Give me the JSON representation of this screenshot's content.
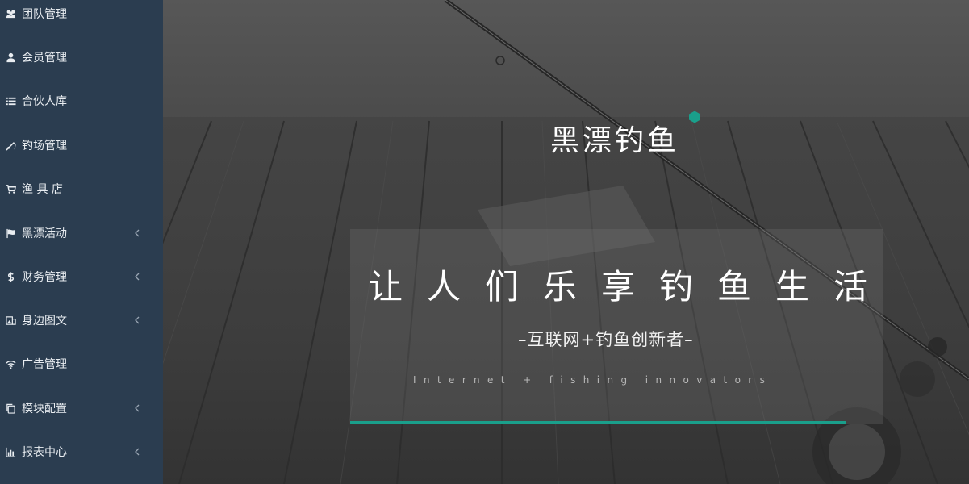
{
  "sidebar": {
    "items": [
      {
        "label": "团队管理",
        "icon": "users-icon",
        "has_submenu": false
      },
      {
        "label": "会员管理",
        "icon": "user-icon",
        "has_submenu": false
      },
      {
        "label": "合伙人库",
        "icon": "list-icon",
        "has_submenu": false
      },
      {
        "label": "钓场管理",
        "icon": "fishing-rod-icon",
        "has_submenu": false
      },
      {
        "label": "渔 具 店",
        "icon": "cart-icon",
        "has_submenu": false
      },
      {
        "label": "黑漂活动",
        "icon": "flag-icon",
        "has_submenu": true
      },
      {
        "label": "财务管理",
        "icon": "dollar-icon",
        "has_submenu": true
      },
      {
        "label": "身边图文",
        "icon": "image-text-icon",
        "has_submenu": true
      },
      {
        "label": "广告管理",
        "icon": "wifi-icon",
        "has_submenu": false
      },
      {
        "label": "模块配置",
        "icon": "copy-icon",
        "has_submenu": true
      },
      {
        "label": "报表中心",
        "icon": "bar-chart-icon",
        "has_submenu": true
      }
    ]
  },
  "hero": {
    "brand": "黑漂钓鱼",
    "slogan": "让人们乐享钓鱼生活",
    "subtitle": "–互联网+钓鱼创新者–",
    "english": "Internet + fishing innovators"
  },
  "colors": {
    "sidebar_bg": "#2b3d50",
    "accent": "#1a9f8b",
    "text": "#ffffff"
  }
}
